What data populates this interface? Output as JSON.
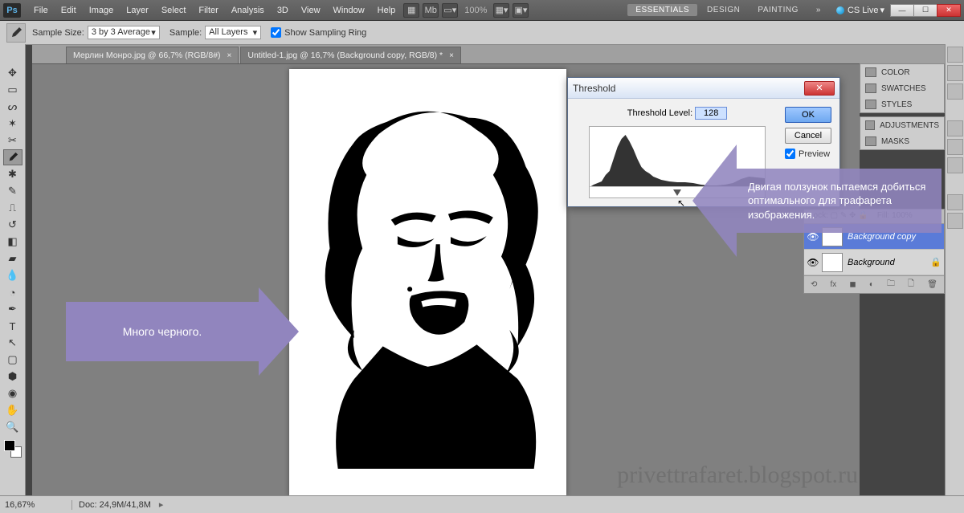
{
  "menubar": {
    "items": [
      "File",
      "Edit",
      "Image",
      "Layer",
      "Select",
      "Filter",
      "Analysis",
      "3D",
      "View",
      "Window",
      "Help"
    ],
    "zoom": "100%",
    "workspaces": [
      "ESSENTIALS",
      "DESIGN",
      "PAINTING"
    ],
    "cslive": "CS Live"
  },
  "options": {
    "sample_size_label": "Sample Size:",
    "sample_size_value": "3 by 3 Average",
    "sample_label": "Sample:",
    "sample_value": "All Layers",
    "show_ring": "Show Sampling Ring"
  },
  "tabs": [
    {
      "label": "Мерлин Монро.jpg @ 66,7% (RGB/8#)",
      "active": false
    },
    {
      "label": "Untitled-1.jpg @ 16,7% (Background copy, RGB/8) *",
      "active": true
    }
  ],
  "panels": {
    "right_tabs": [
      "COLOR",
      "SWATCHES",
      "STYLES",
      "ADJUSTMENTS",
      "MASKS",
      "PATHS"
    ]
  },
  "layers": {
    "rows": [
      {
        "name": "Background copy",
        "selected": true,
        "locked": false
      },
      {
        "name": "Background",
        "selected": false,
        "locked": true
      }
    ]
  },
  "dialog": {
    "title": "Threshold",
    "level_label": "Threshold Level:",
    "level_value": "128",
    "ok": "OK",
    "cancel": "Cancel",
    "preview": "Preview"
  },
  "annotations": {
    "left": "Много черного.",
    "right": "Двигая ползунок пытаемся добиться оптимального для трафарета изображения."
  },
  "watermark": "privettrafaret.blogspot.ru",
  "status": {
    "zoom": "16,67%",
    "doc": "Doc: 24,9M/41,8M"
  },
  "tool_icons": [
    "↔",
    "▭",
    "◌",
    "✂",
    "✎",
    "◢",
    "✐",
    "⌫",
    "▦",
    "△",
    "⎚",
    "◔",
    "◒",
    "✏",
    "T",
    "↖",
    "⎌",
    "✋",
    "🔍"
  ]
}
